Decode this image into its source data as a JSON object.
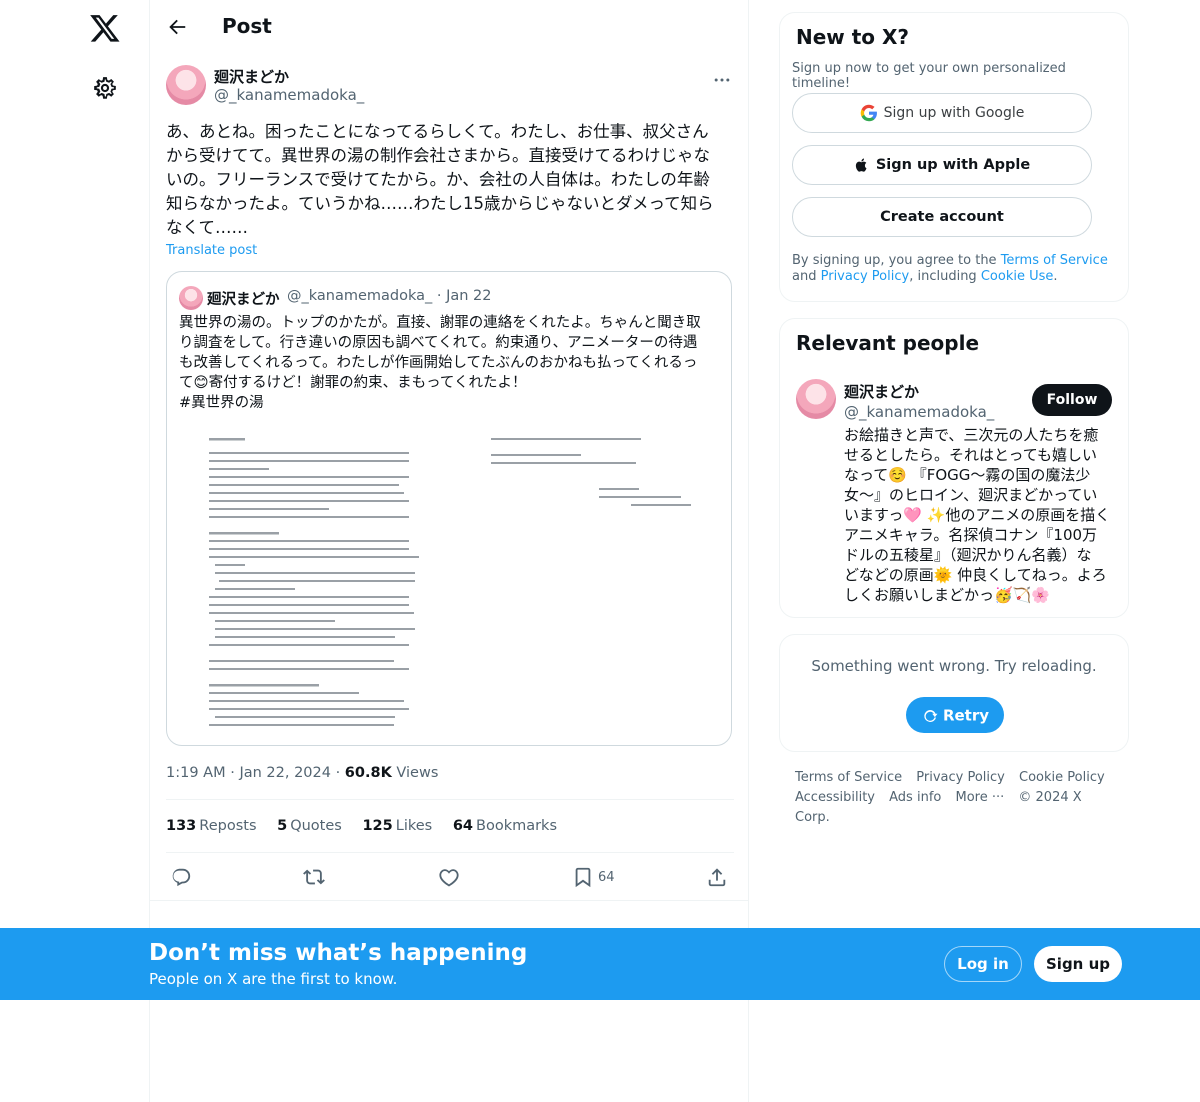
{
  "header": {
    "title": "Post"
  },
  "post": {
    "author_name": "廻沢まどか",
    "author_handle": "@_kanamemadoka_",
    "text": "あ、あとね。困ったことになってるらしくて。わたし、お仕事、叔父さん\nから受けてて。異世界の湯の制作会社さまから。直接受けてるわけじゃな\nいの。フリーランスで受けてたから。か、会社の人自体は。わたしの年齢\n知らなかったよ。ていうかね……わたし15歳からじゃないとダメって知ら\nなくて……",
    "translate_label": "Translate post",
    "time": "1:19 AM",
    "date": "Jan 22, 2024",
    "views_count": "60.8K",
    "views_label": "Views",
    "reposts_count": "133",
    "reposts_label": "Reposts",
    "quotes_count": "5",
    "quotes_label": "Quotes",
    "likes_count": "125",
    "likes_label": "Likes",
    "bookmarks_count": "64",
    "bookmarks_label": "Bookmarks",
    "bookmark_action_count": "64"
  },
  "quote": {
    "author_name": "廻沢まどか",
    "author_handle": "@_kanamemadoka_",
    "date": "Jan 22",
    "text": "異世界の湯の。トップのかたが。直接、謝罪の連絡をくれたよ。ちゃんと聞き取\nり調査をして。行き違いの原因も調べてくれて。約束通り、アニメーターの待遇\nも改善してくれるって。わたしが作画開始してたぶんのおかねも払ってくれるっ\nて😊寄付するけど！謝罪の約束、まもってくれたよ！\n#異世界の湯"
  },
  "signup_card": {
    "title": "New to X?",
    "subtitle": "Sign up now to get your own personalized timeline!",
    "google_label": "Sign up with Google",
    "apple_label": "Sign up with Apple",
    "create_label": "Create account",
    "legal_prefix": "By signing up, you agree to the ",
    "terms_link": "Terms of Service",
    "legal_and": " and",
    "privacy_link": "Privacy Policy",
    "legal_including": ", including ",
    "cookie_link": "Cookie Use",
    "legal_end": "."
  },
  "relevant_people": {
    "title": "Relevant people",
    "name": "廻沢まどか",
    "handle": "@_kanamemadoka_",
    "follow_label": "Follow",
    "bio": "お絵描きと声で、三次元の人たちを癒\nせるとしたら。それはとっても嬉しい\nなって☺️ 『FOGG〜霧の国の魔法少\n女〜』のヒロイン、廻沢まどかってい\nいますっ🩷 ✨他のアニメの原画を描く\nアニメキャラ。名探偵コナン『100万\nドルの五稜星』（廻沢かりん名義）な\nどなどの原画🌞 仲良くしてねっ。よろ\nしくお願いしまどかっ🥳🏹🌸"
  },
  "error_card": {
    "message": "Something went wrong. Try reloading.",
    "retry_label": "Retry"
  },
  "footer": {
    "terms": "Terms of Service",
    "privacy": "Privacy Policy",
    "cookie": "Cookie Policy",
    "accessibility": "Accessibility",
    "ads": "Ads info",
    "more": "More ···",
    "copyright": "© 2024 X Corp."
  },
  "banner": {
    "title": "Don’t miss what’s happening",
    "subtitle": "People on X are the first to know.",
    "login_label": "Log in",
    "signup_label": "Sign up"
  },
  "colors": {
    "accent": "#1d9bf0",
    "text": "#0f1419",
    "secondary": "#536471",
    "border": "#eff3f4"
  },
  "icons": [
    "x-logo-icon",
    "gear-icon",
    "back-arrow-icon",
    "more-icon",
    "reply-icon",
    "repost-icon",
    "like-icon",
    "bookmark-icon",
    "share-icon",
    "google-icon",
    "apple-icon",
    "refresh-icon"
  ]
}
